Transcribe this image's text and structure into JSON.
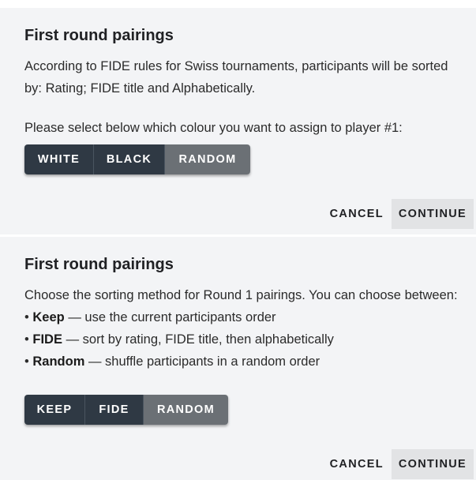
{
  "dialog1": {
    "title": "First round pairings",
    "description": "According to FIDE rules for Swiss tournaments, participants will be sorted by: Rating; FIDE title and Alphabetically.",
    "prompt": "Please select below which colour you want to assign to player #1:",
    "options": [
      {
        "label": "WHITE",
        "selected": false
      },
      {
        "label": "BLACK",
        "selected": false
      },
      {
        "label": "RANDOM",
        "selected": true
      }
    ],
    "cancel_label": "CANCEL",
    "continue_label": "CONTINUE"
  },
  "dialog2": {
    "title": "First round pairings",
    "intro": "Choose the sorting method for Round 1 pairings. You can choose between:",
    "bullet_char": "•",
    "items": [
      {
        "term": "Keep",
        "desc": "— use the current participants order"
      },
      {
        "term": "FIDE",
        "desc": "— sort by rating, FIDE title, then alphabetically"
      },
      {
        "term": "Random",
        "desc": "— shuffle participants in a random order"
      }
    ],
    "options": [
      {
        "label": "KEEP",
        "selected": false
      },
      {
        "label": "FIDE",
        "selected": false
      },
      {
        "label": "RANDOM",
        "selected": true
      }
    ],
    "cancel_label": "CANCEL",
    "continue_label": "CONTINUE"
  },
  "colors": {
    "dialog_bg": "#f3f4f6",
    "segment_dark": "#2f3944",
    "segment_selected": "#6b7075",
    "continue_bg": "#e2e3e5"
  }
}
